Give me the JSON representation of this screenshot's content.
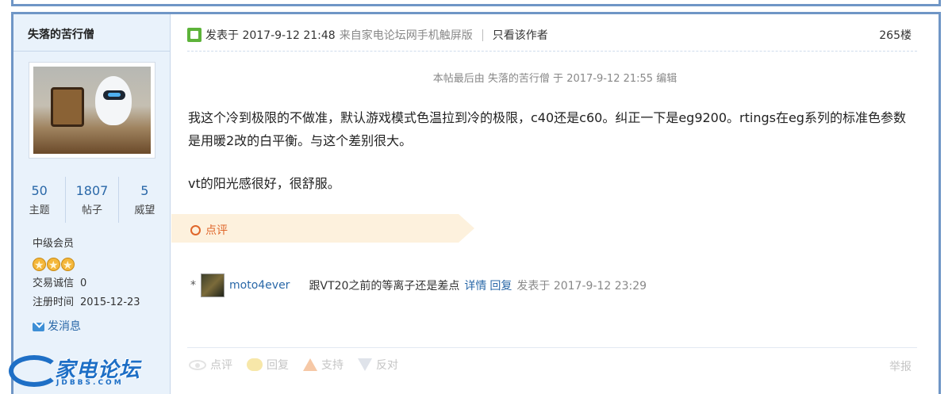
{
  "author": {
    "name": "失落的苦行僧",
    "stats": [
      {
        "value": "50",
        "label": "主题"
      },
      {
        "value": "1807",
        "label": "帖子"
      },
      {
        "value": "5",
        "label": "威望"
      }
    ],
    "rank": "中级会员",
    "rank_stars": 3,
    "credit_label": "交易诚信",
    "credit_value": "0",
    "reg_label": "注册时间",
    "reg_value": "2015-12-23",
    "send_message": "发消息"
  },
  "logo": {
    "text": "家电论坛",
    "sub": "JDBBS.COM"
  },
  "post": {
    "posted_prefix": "发表于 2017-9-12 21:48",
    "source": "来自家电论坛网手机触屏版",
    "only_author": "只看该作者",
    "floor": "265楼",
    "edited_note": "本帖最后由 失落的苦行僧 于 2017-9-12 21:55 编辑",
    "paragraphs": [
      "我这个冷到极限的不做准，默认游戏模式色温拉到冷的极限，c40还是c60。纠正一下是eg9200。rtings在eg系列的标准色参数是用暖2改的白平衡。与这个差别很大。",
      "vt的阳光感很好，很舒服。"
    ]
  },
  "review": {
    "header": "点评",
    "comment": {
      "bullet": "*",
      "user": "moto4ever",
      "text": "跟VT20之前的等离子还是差点",
      "detail": "详情",
      "reply": "回复",
      "time": "发表于 2017-9-12 23:29"
    }
  },
  "actions": {
    "comment": "点评",
    "reply": "回复",
    "support": "支持",
    "oppose": "反对",
    "report": "举报"
  },
  "colors": {
    "accent": "#2a68a8",
    "border": "#6f96c6",
    "sidebar_bg": "#e9f2fb",
    "review_accent": "#e0662a"
  }
}
